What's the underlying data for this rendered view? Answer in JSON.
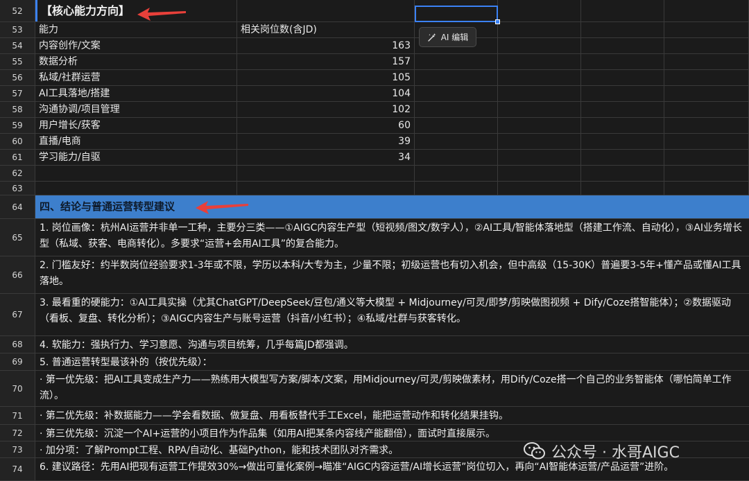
{
  "selection_action": {
    "label": "AI 编辑",
    "icon": "magic-wand-edit-icon"
  },
  "colors": {
    "section_fill": "#3d7fcc",
    "selection": "#3b82f6",
    "arrow": "#e8403a"
  },
  "rows": {
    "r52": {
      "num": "52",
      "text": "【核心能力方向】"
    },
    "r53": {
      "num": "53",
      "col_a": "能力",
      "col_b": "相关岗位数(含JD)"
    },
    "r62": {
      "num": "62"
    },
    "r63": {
      "num": "63"
    },
    "r64": {
      "num": "64",
      "text": "四、结论与普通运营转型建议"
    },
    "r65": {
      "num": "65",
      "text": "1. 岗位画像：杭州AI运营并非单一工种，主要分三类——①AIGC内容生产型（短视频/图文/数字人），②AI工具/智能体落地型（搭建工作流、自动化），③AI业务增长型（私域、获客、电商转化）。多要求“运营+会用AI工具”的复合能力。"
    },
    "r66": {
      "num": "66",
      "text": "2. 门槛友好：约半数岗位经验要求1-3年或不限，学历以本科/大专为主，少量不限；初级运营也有切入机会，但中高级（15-30K）普遍要3-5年+懂产品或懂AI工具落地。"
    },
    "r67": {
      "num": "67",
      "text": "3. 最看重的硬能力：①AI工具实操（尤其ChatGPT/DeepSeek/豆包/通义等大模型 + Midjourney/可灵/即梦/剪映做图视频 + Dify/Coze搭智能体）；②数据驱动（看板、复盘、转化分析）；③AIGC内容生产与账号运营（抖音/小红书）；④私域/社群与获客转化。"
    },
    "r68": {
      "num": "68",
      "text": "4. 软能力：强执行力、学习意愿、沟通与项目统筹，几乎每篇JD都强调。"
    },
    "r69": {
      "num": "69",
      "text": "5. 普通运营转型最该补的（按优先级）："
    },
    "r70": {
      "num": "70",
      "text": "  · 第一优先级：把AI工具变成生产力——熟练用大模型写方案/脚本/文案，用Midjourney/可灵/剪映做素材，用Dify/Coze搭一个自己的业务智能体（哪怕简单工作流）。"
    },
    "r71": {
      "num": "71",
      "text": "  · 第二优先级：补数据能力——学会看数据、做复盘、用看板替代手工Excel，能把运营动作和转化结果挂钩。"
    },
    "r72": {
      "num": "72",
      "text": "  · 第三优先级：沉淀一个AI+运营的小项目作为作品集（如用AI把某条内容线产能翻倍），面试时直接展示。"
    },
    "r73": {
      "num": "73",
      "text": "  · 加分项：了解Prompt工程、RPA/自动化、基础Python，能和技术团队对齐需求。"
    },
    "r74": {
      "num": "74",
      "text": "6. 建议路径：先用AI把现有运营工作提效30%→做出可量化案例→瞄准“AIGC内容运营/AI增长运营”岗位切入，再向“AI智能体运营/产品运营”进阶。"
    }
  },
  "ability_table": [
    {
      "num": "54",
      "ability": "内容创作/文案",
      "count": "163"
    },
    {
      "num": "55",
      "ability": "数据分析",
      "count": "157"
    },
    {
      "num": "56",
      "ability": "私域/社群运营",
      "count": "105"
    },
    {
      "num": "57",
      "ability": "AI工具落地/搭建",
      "count": "104"
    },
    {
      "num": "58",
      "ability": "沟通协调/项目管理",
      "count": "102"
    },
    {
      "num": "59",
      "ability": "用户增长/获客",
      "count": "60"
    },
    {
      "num": "60",
      "ability": "直播/电商",
      "count": "39"
    },
    {
      "num": "61",
      "ability": "学习能力/自驱",
      "count": "34"
    }
  ],
  "watermark": {
    "text": "公众号 · 水哥AIGC",
    "icon": "wechat-logo-icon"
  }
}
